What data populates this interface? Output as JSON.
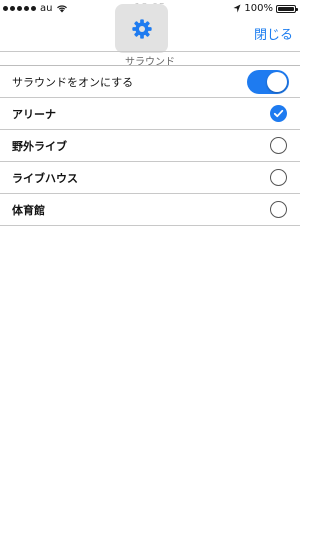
{
  "status_bar": {
    "carrier": "au",
    "time": "18:05",
    "battery_percent": "100%",
    "signal_dots_filled": 5
  },
  "header": {
    "close_label": "閉じる",
    "section_title": "サラウンド"
  },
  "surround_toggle": {
    "label": "サラウンドをオンにする",
    "on": true
  },
  "options": [
    {
      "label": "アリーナ",
      "selected": true
    },
    {
      "label": "野外ライブ",
      "selected": false
    },
    {
      "label": "ライブハウス",
      "selected": false
    },
    {
      "label": "体育館",
      "selected": false
    }
  ],
  "colors": {
    "accent": "#1e7bf0",
    "link": "#1a7cf0",
    "separator": "#c8c8c8"
  }
}
